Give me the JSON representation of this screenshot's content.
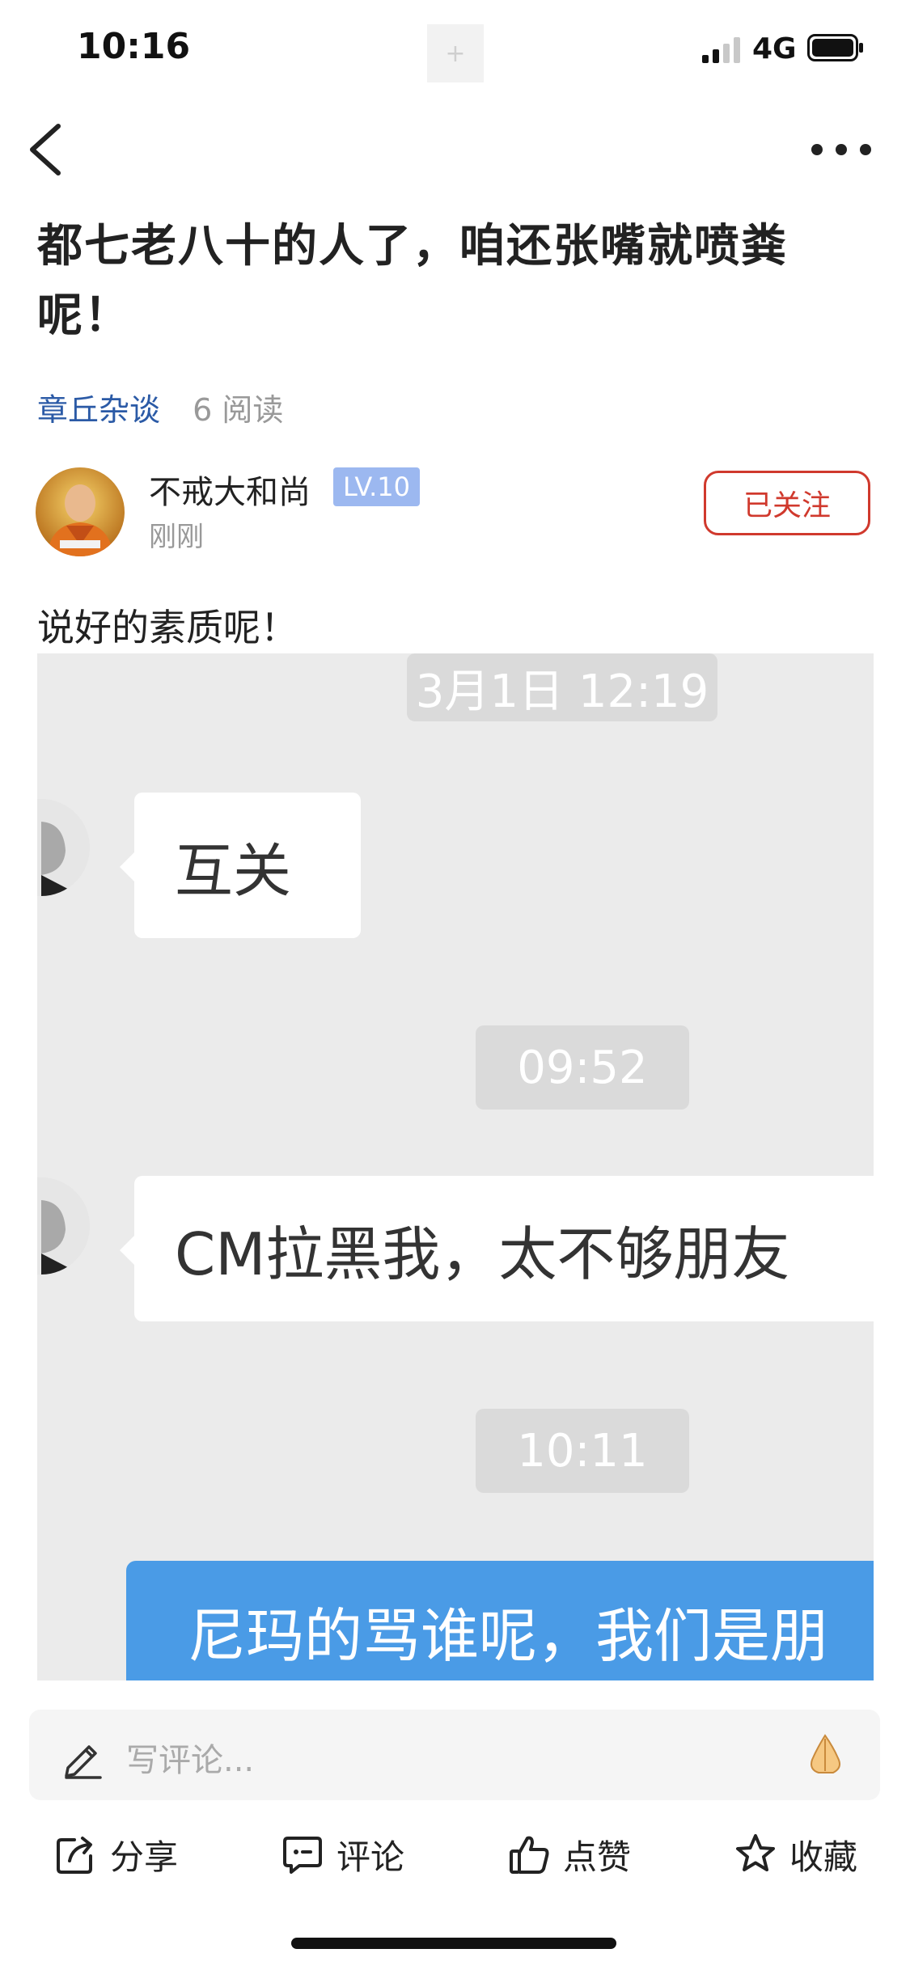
{
  "status_bar": {
    "time": "10:16",
    "network": "4G",
    "notch_symbol": "+"
  },
  "article": {
    "title": "都七老八十的人了，咱还张嘴就喷粪呢！",
    "channel": "章丘杂谈",
    "reads": "6 阅读",
    "body": "说好的素质呢！"
  },
  "author": {
    "name": "不戒大和尚",
    "level": "LV.10",
    "time": "刚刚",
    "follow_label": "已关注"
  },
  "chat": {
    "timestamps": [
      "3月1日 12:19",
      "09:52",
      "10:11"
    ],
    "messages": [
      {
        "side": "left",
        "text": "互关"
      },
      {
        "side": "left",
        "text": "CM拉黑我，太不够朋友"
      },
      {
        "side": "right",
        "text": "尼玛的骂谁呢，我们是朋"
      }
    ]
  },
  "comment_bar": {
    "placeholder": "写评论..."
  },
  "actions": {
    "share": "分享",
    "comment": "评论",
    "like": "点赞",
    "favorite": "收藏"
  },
  "colors": {
    "link_blue": "#2b5aa6",
    "follow_red": "#d0392d",
    "level_badge": "#9cb8f0",
    "chat_blue": "#4a9be6",
    "chat_bg": "#ebebeb"
  }
}
